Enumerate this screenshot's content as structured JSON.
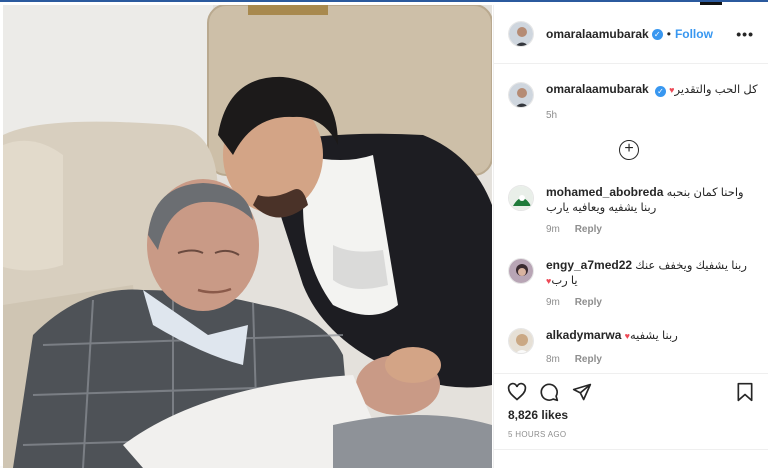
{
  "header": {
    "username": "omaralaamubarak",
    "separator": "•",
    "follow_label": "Follow",
    "more_label": "•••"
  },
  "caption": {
    "username": "omaralaamubarak",
    "text": "كل الحب والتقدير",
    "time": "5h"
  },
  "load_more_label": "+",
  "comments": [
    {
      "username": "mohamed_abobreda",
      "text_line1": "واحنا كمان بنحبه",
      "text_line2": "ربنا يشفيه ويعافيه يارب",
      "time": "9m",
      "reply_label": "Reply"
    },
    {
      "username": "engy_a7med22",
      "text_line1": "ربنا يشفيك ويخفف عنك",
      "text_line2": "يا رب",
      "time": "9m",
      "reply_label": "Reply"
    },
    {
      "username": "alkadymarwa",
      "text_line1": "ربنا يشفيه",
      "time": "8m",
      "reply_label": "Reply"
    }
  ],
  "likes": "8,826 likes",
  "posted": "5 HOURS AGO",
  "icons": {
    "like": "heart-outline-icon",
    "comment": "comment-bubble-icon",
    "share": "paper-plane-icon",
    "save": "bookmark-icon",
    "verified": "verified-badge-icon"
  },
  "colors": {
    "accent": "#3897f0",
    "heart": "#ed4956",
    "muted": "#8e8e8e"
  }
}
